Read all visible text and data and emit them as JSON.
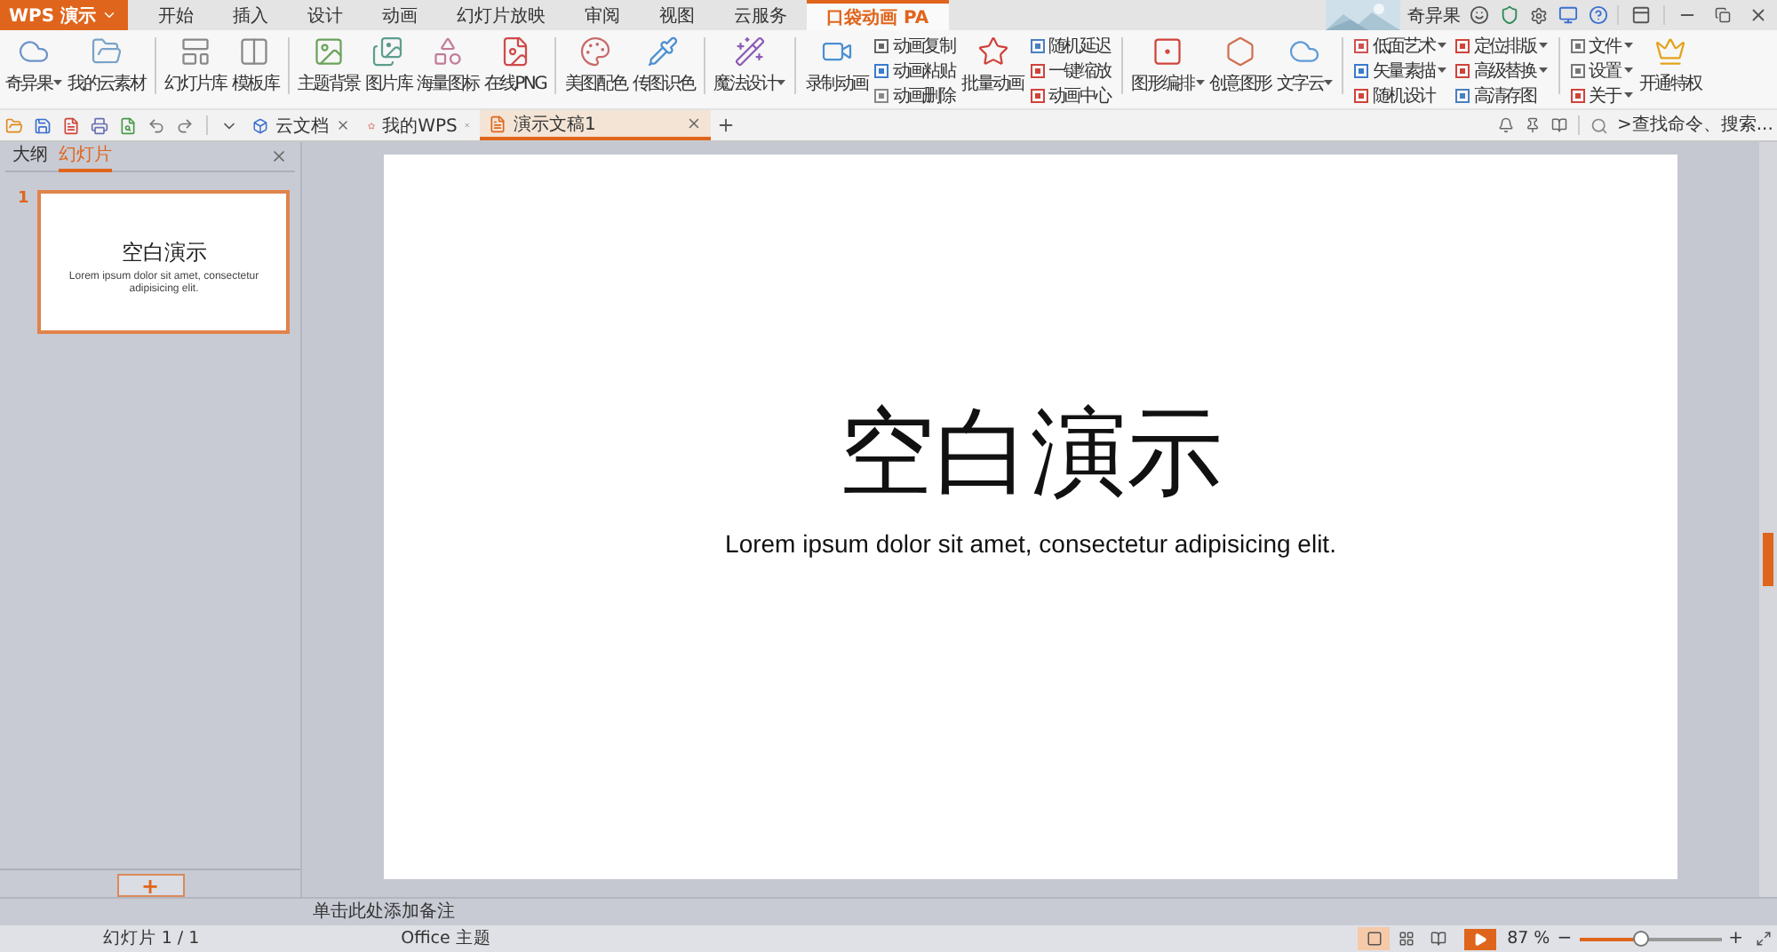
{
  "app_menu": {
    "label": "WPS 演示"
  },
  "menu_tabs": [
    {
      "label": "开始",
      "selected": false
    },
    {
      "label": "插入",
      "selected": false
    },
    {
      "label": "设计",
      "selected": false
    },
    {
      "label": "动画",
      "selected": false
    },
    {
      "label": "幻灯片放映",
      "selected": false
    },
    {
      "label": "审阅",
      "selected": false
    },
    {
      "label": "视图",
      "selected": false
    },
    {
      "label": "云服务",
      "selected": false
    },
    {
      "label": "口袋动画 PA",
      "selected": true
    }
  ],
  "account": {
    "name": "奇异果"
  },
  "ribbon": {
    "groups": [
      {
        "columns": [
          {
            "kind": "large",
            "label": "奇异果",
            "dropdown": true
          },
          {
            "kind": "large",
            "label": "我的云素材",
            "dropdown": false
          }
        ]
      },
      {
        "columns": [
          {
            "kind": "large",
            "label": "幻灯片库",
            "dropdown": false
          },
          {
            "kind": "large",
            "label": "模板库",
            "dropdown": false
          }
        ]
      },
      {
        "columns": [
          {
            "kind": "large",
            "label": "主题背景",
            "dropdown": false
          },
          {
            "kind": "large",
            "label": "图片库",
            "dropdown": false
          },
          {
            "kind": "large",
            "label": "海量图标",
            "dropdown": false
          },
          {
            "kind": "large",
            "label": "在线PNG",
            "dropdown": false
          }
        ]
      },
      {
        "columns": [
          {
            "kind": "large",
            "label": "美图配色",
            "dropdown": false
          },
          {
            "kind": "large",
            "label": "传图识色",
            "dropdown": false
          }
        ]
      },
      {
        "columns": [
          {
            "kind": "large",
            "label": "魔法设计",
            "dropdown": true
          }
        ]
      },
      {
        "columns": [
          {
            "kind": "large",
            "label": "录制动画",
            "dropdown": false
          },
          {
            "kind": "stack",
            "items": [
              {
                "label": "动画复制",
                "dropdown": false
              },
              {
                "label": "动画粘贴",
                "dropdown": false
              },
              {
                "label": "动画删除",
                "dropdown": false
              }
            ]
          },
          {
            "kind": "large",
            "label": "批量动画",
            "dropdown": false
          },
          {
            "kind": "stack",
            "items": [
              {
                "label": "随机延迟",
                "dropdown": false
              },
              {
                "label": "一键缩放",
                "dropdown": false
              },
              {
                "label": "动画中心",
                "dropdown": false
              }
            ]
          }
        ]
      },
      {
        "columns": [
          {
            "kind": "large",
            "label": "图形编排",
            "dropdown": true
          },
          {
            "kind": "large",
            "label": "创意图形",
            "dropdown": false
          },
          {
            "kind": "large",
            "label": "文字云",
            "dropdown": true
          }
        ]
      },
      {
        "columns": [
          {
            "kind": "stack",
            "items": [
              {
                "label": "低面艺术",
                "dropdown": true
              },
              {
                "label": "矢量素描",
                "dropdown": true
              },
              {
                "label": "随机设计",
                "dropdown": false
              }
            ]
          },
          {
            "kind": "stack",
            "items": [
              {
                "label": "定位排版",
                "dropdown": true
              },
              {
                "label": "高级替换",
                "dropdown": true
              },
              {
                "label": "高清存图",
                "dropdown": false
              }
            ]
          }
        ]
      },
      {
        "columns": [
          {
            "kind": "stack",
            "items": [
              {
                "label": "文件",
                "dropdown": true
              },
              {
                "label": "设置",
                "dropdown": true
              },
              {
                "label": "关于",
                "dropdown": true
              }
            ]
          },
          {
            "kind": "large",
            "label": "开通特权",
            "dropdown": false
          }
        ]
      }
    ]
  },
  "doc_tabs": [
    {
      "label": "云文档",
      "selected": false
    },
    {
      "label": "我的WPS",
      "selected": false
    },
    {
      "label": "演示文稿1",
      "selected": true
    }
  ],
  "search": {
    "placeholder": ">查找命令、搜索..."
  },
  "side_panel": {
    "tabs": [
      {
        "label": "大纲",
        "selected": false
      },
      {
        "label": "幻灯片",
        "selected": true
      }
    ],
    "slides": [
      {
        "number": "1",
        "title": "空白演示",
        "subtitle": "Lorem ipsum dolor sit amet, consectetur adipisicing elit.",
        "selected": true
      }
    ],
    "add_button": "+"
  },
  "slide": {
    "title": "空白演示",
    "subtitle": "Lorem ipsum dolor sit amet, consectetur adipisicing elit."
  },
  "notes": {
    "placeholder": "单击此处添加备注"
  },
  "status_bar": {
    "slide_count": "幻灯片 1 / 1",
    "theme": "Office 主题",
    "views": [
      {
        "kind": "normal",
        "selected": true
      },
      {
        "kind": "sorter",
        "selected": false
      },
      {
        "kind": "reading",
        "selected": false
      }
    ],
    "zoom": "87 %",
    "zoom_out": "−",
    "zoom_in": "+",
    "zoom_slider": {
      "level": 0.43
    }
  }
}
